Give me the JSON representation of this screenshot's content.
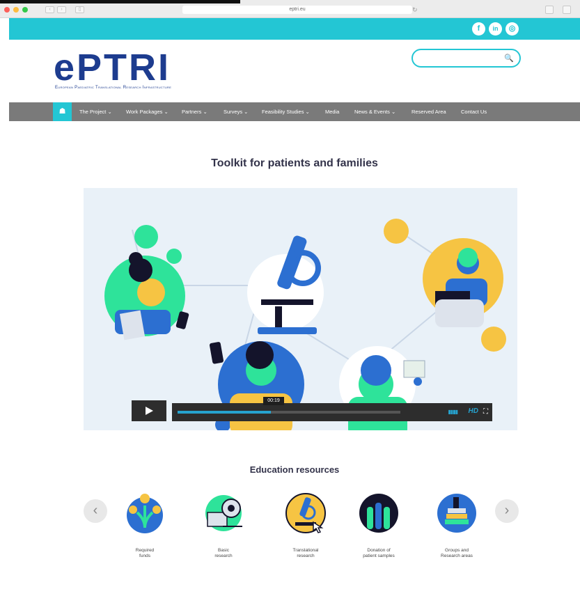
{
  "browser": {
    "url": "eptri.eu",
    "traffic_light_colors": [
      "#fc605b",
      "#fdbc40",
      "#34c84a"
    ]
  },
  "topbar": {
    "color": "#23c6d4",
    "social": [
      {
        "icon": "facebook-icon",
        "glyph": "f"
      },
      {
        "icon": "linkedin-icon",
        "glyph": "in"
      },
      {
        "icon": "instagram-icon",
        "glyph": "◎"
      }
    ]
  },
  "logo": {
    "text": "ePTRI",
    "subtitle": "European Paediatric Translational Research Infrastructure"
  },
  "search": {
    "placeholder": "",
    "value": "",
    "icon": "search-icon"
  },
  "nav": {
    "home_icon": "home-icon",
    "items": [
      {
        "label": "The Project",
        "has_dropdown": true
      },
      {
        "label": "Work Packages",
        "has_dropdown": true
      },
      {
        "label": "Partners",
        "has_dropdown": true
      },
      {
        "label": "Surveys",
        "has_dropdown": true
      },
      {
        "label": "Feasibility Studies",
        "has_dropdown": true
      },
      {
        "label": "Media",
        "has_dropdown": false
      },
      {
        "label": "News & Events",
        "has_dropdown": true
      },
      {
        "label": "Reserved Area",
        "has_dropdown": false
      },
      {
        "label": "Contact Us",
        "has_dropdown": false
      }
    ]
  },
  "toolkit": {
    "title": "Toolkit for patients and families",
    "video": {
      "time": "00:19",
      "progress": 0.42,
      "hd_label": "HD",
      "play_icon": "play-icon",
      "volume_icon": "volume-icon",
      "fullscreen_icon": "fullscreen-icon"
    }
  },
  "education": {
    "title": "Education resources",
    "prev_icon": "chevron-left-icon",
    "next_icon": "chevron-right-icon",
    "items": [
      {
        "label_line1": "Required",
        "label_line2": "funds"
      },
      {
        "label_line1": "Basic",
        "label_line2": "research"
      },
      {
        "label_line1": "Translational",
        "label_line2": "research"
      },
      {
        "label_line1": "Donation of",
        "label_line2": "patient samples"
      },
      {
        "label_line1": "Groups and",
        "label_line2": "Research areas"
      }
    ]
  },
  "colors": {
    "accent": "#23c6d4",
    "brand_navy": "#1d3c8f",
    "nav_gray": "#7a7a7a",
    "illustration_green": "#2ee39a",
    "illustration_yellow": "#f6c443",
    "illustration_blue": "#2c6fd1"
  }
}
